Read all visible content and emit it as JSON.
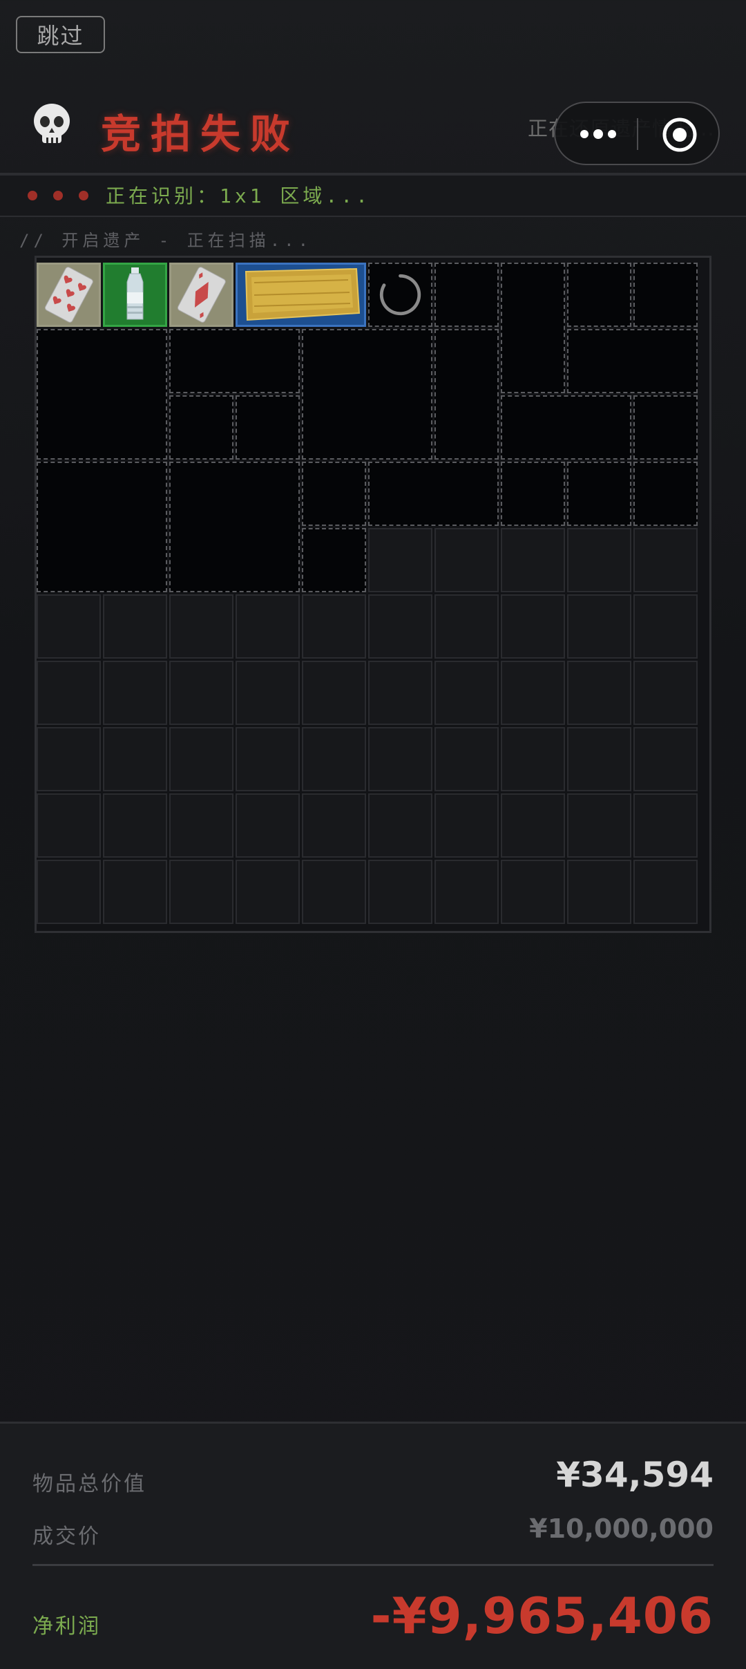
{
  "skip_label": "跳过",
  "header": {
    "title": "竞拍失败",
    "restore_text": "正在还原遗产情况..."
  },
  "status": {
    "text": "正在识别：1x1 区域..."
  },
  "scan_text": "// 开启遗产 - 正在扫描...",
  "grid": {
    "items": [
      {
        "name": "playing-card-hearts",
        "color": "gray"
      },
      {
        "name": "water-bottle",
        "color": "green"
      },
      {
        "name": "playing-card-diamonds",
        "color": "gray"
      },
      {
        "name": "gold-bar",
        "color": "blue"
      }
    ]
  },
  "summary": {
    "total_value_label": "物品总价值",
    "total_value": "¥34,594",
    "deal_price_label": "成交价",
    "deal_price": "¥10,000,000",
    "net_profit_label": "净利润",
    "net_profit": "-¥9,965,406"
  },
  "colors": {
    "danger": "#c83a2d",
    "success_text": "#7cab4f",
    "rarity_gray": "#8a8a70",
    "rarity_green": "#1f7a2d",
    "rarity_blue": "#1c4d8d"
  }
}
